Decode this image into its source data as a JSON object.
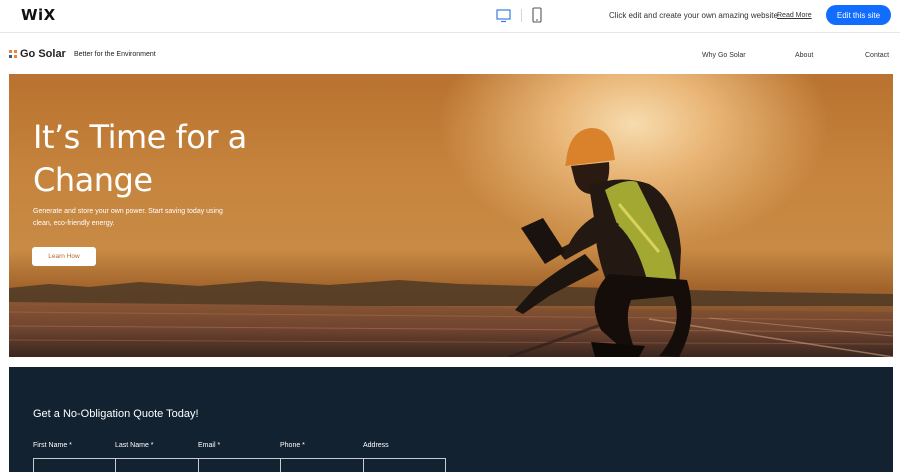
{
  "wix_bar": {
    "logo": "WiX",
    "promo_text": "Click edit and create your own amazing website",
    "read_more": "Read More",
    "edit_button": "Edit this site",
    "accent": "#116dff"
  },
  "header": {
    "brand_name": "Go Solar",
    "tagline": "Better for the Environment",
    "nav": [
      "Why Go Solar",
      "About",
      "Contact"
    ]
  },
  "hero": {
    "title": "It’s Time for a Change",
    "subtitle": "Generate and store your own power. Start saving today using clean, eco-friendly energy.",
    "button": "Learn How"
  },
  "quote": {
    "title": "Get a No-Obligation Quote Today!",
    "fields": [
      {
        "label": "First Name *"
      },
      {
        "label": "Last Name *"
      },
      {
        "label": "Email *"
      },
      {
        "label": "Phone *"
      },
      {
        "label": "Address"
      }
    ],
    "background": "#132231"
  },
  "icons": [
    "desktop-icon",
    "mobile-icon",
    "brand-logo-icon"
  ]
}
